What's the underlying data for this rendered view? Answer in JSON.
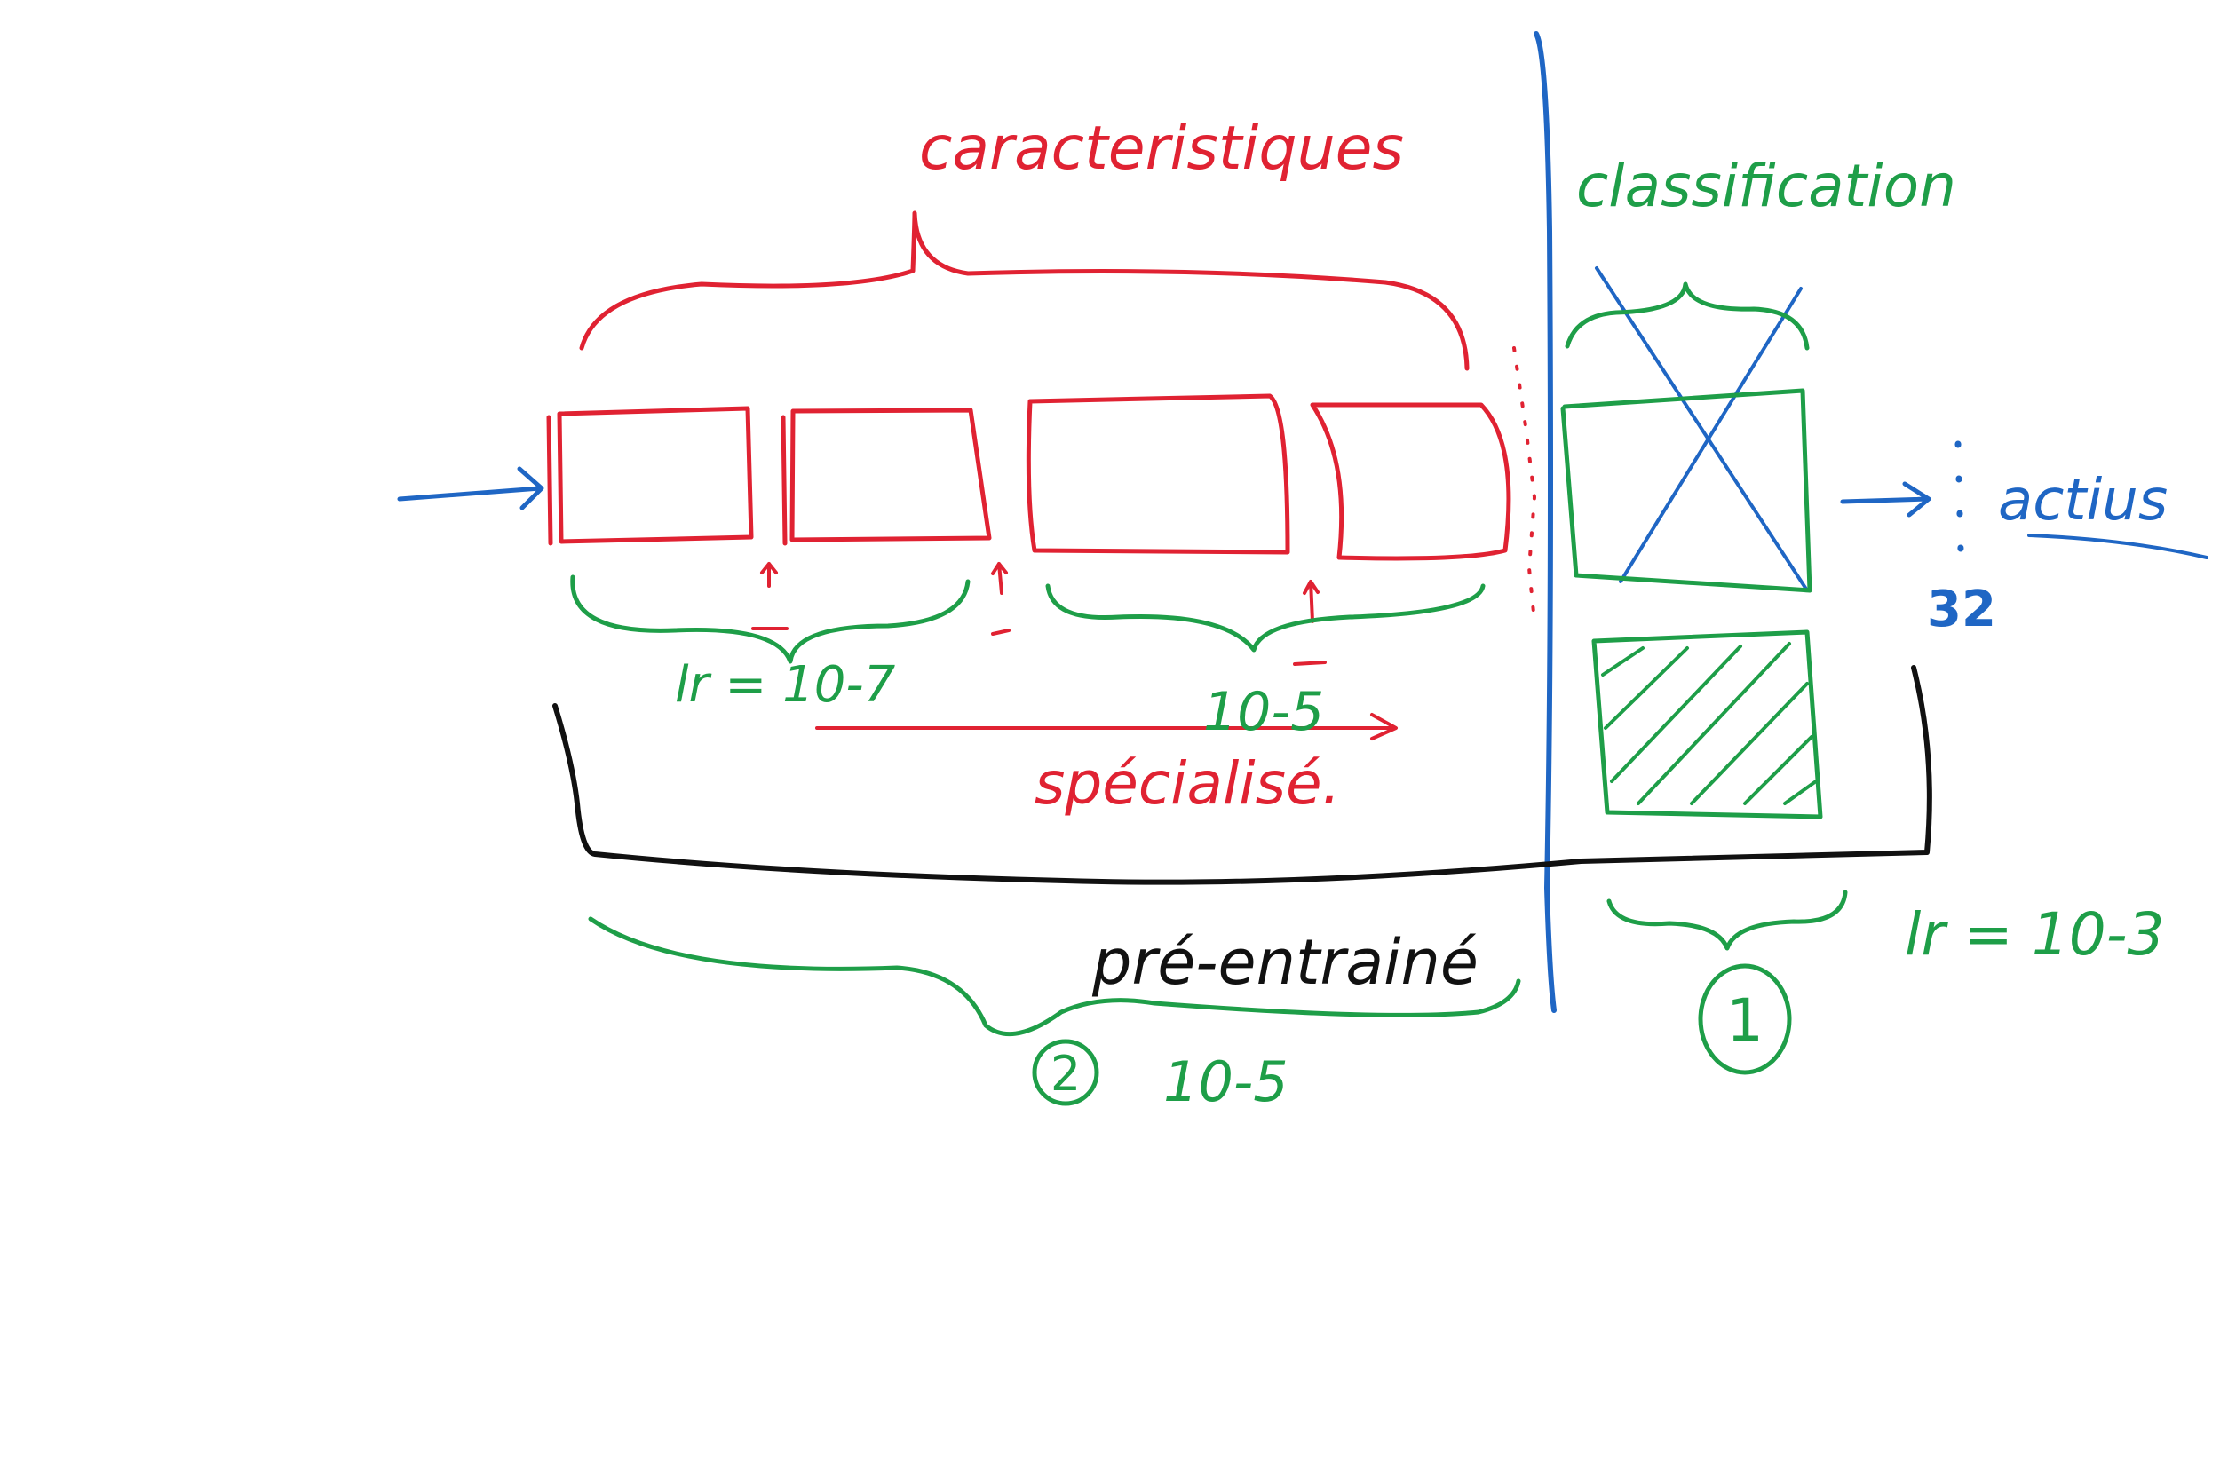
{
  "labels": {
    "features": "caracteristiques",
    "classification": "classification",
    "lr_low": "lr = 10-7",
    "lr_mid": "10-5",
    "specialized": "spécialisé.",
    "pretrained": "pré-entrainé",
    "step2_number": "2",
    "step2_lr": "10-5",
    "step1_number": "1",
    "lr_high": "lr = 10-3",
    "outputs": "actius",
    "output_count": "32"
  },
  "colors": {
    "features": "#e02232",
    "training": "#1e9e48",
    "input_output": "#1f66c4",
    "pretrained": "#111111"
  }
}
